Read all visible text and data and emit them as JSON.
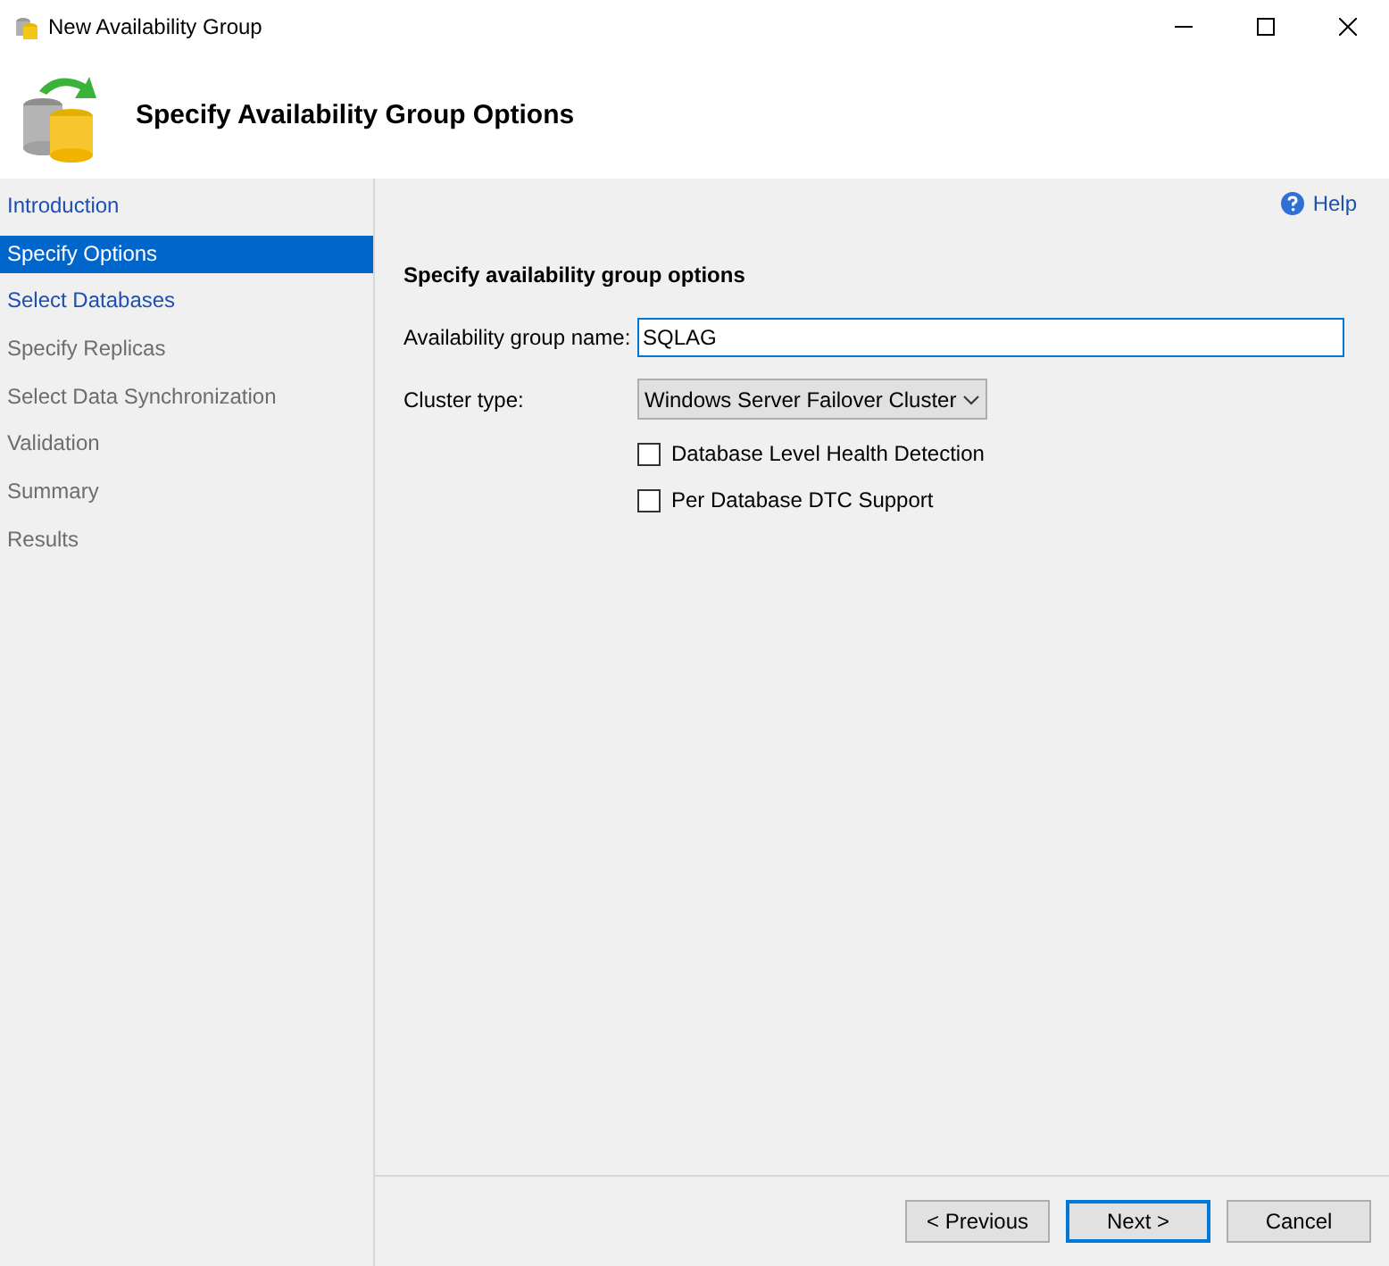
{
  "window": {
    "title": "New Availability Group"
  },
  "header": {
    "title": "Specify Availability Group Options"
  },
  "sidebar": {
    "items": [
      {
        "label": "Introduction",
        "selected": false,
        "disabled": false
      },
      {
        "label": "Specify Options",
        "selected": true,
        "disabled": false
      },
      {
        "label": "Select Databases",
        "selected": false,
        "disabled": false
      },
      {
        "label": "Specify Replicas",
        "selected": false,
        "disabled": true
      },
      {
        "label": "Select Data Synchronization",
        "selected": false,
        "disabled": true
      },
      {
        "label": "Validation",
        "selected": false,
        "disabled": true
      },
      {
        "label": "Summary",
        "selected": false,
        "disabled": true
      },
      {
        "label": "Results",
        "selected": false,
        "disabled": true
      }
    ]
  },
  "help": "Help",
  "section_title": "Specify availability group options",
  "name_field": {
    "label": "Availability group name:",
    "value": "SQLAG"
  },
  "cluster_type": {
    "label": "Cluster type:",
    "value": "Windows Server Failover Cluster"
  },
  "checkboxes": [
    {
      "label": "Database Level Health Detection",
      "checked": false
    },
    {
      "label": "Per Database DTC Support",
      "checked": false
    }
  ],
  "buttons": [
    {
      "label": "< Previous",
      "default": false
    },
    {
      "label": "Next >",
      "default": true
    },
    {
      "label": "Cancel",
      "default": false
    }
  ]
}
